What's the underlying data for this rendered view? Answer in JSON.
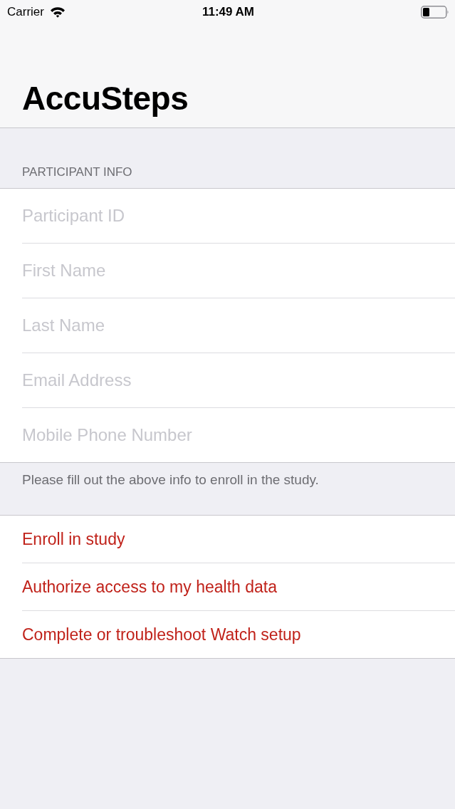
{
  "status_bar": {
    "carrier": "Carrier",
    "time": "11:49 AM"
  },
  "nav": {
    "title": "AccuSteps"
  },
  "participant_info": {
    "header": "PARTICIPANT INFO",
    "fields": [
      {
        "placeholder": "Participant ID"
      },
      {
        "placeholder": "First Name"
      },
      {
        "placeholder": "Last Name"
      },
      {
        "placeholder": "Email Address"
      },
      {
        "placeholder": "Mobile Phone Number"
      }
    ],
    "footer": "Please fill out the above info to enroll in the study."
  },
  "actions": [
    "Enroll in study",
    "Authorize access to my health data",
    "Complete or troubleshoot Watch setup"
  ]
}
